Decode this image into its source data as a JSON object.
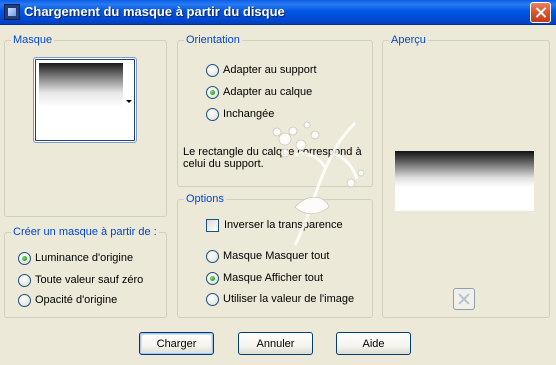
{
  "window": {
    "title": "Chargement du masque à partir du disque"
  },
  "groups": {
    "masque": "Masque",
    "orientation": "Orientation",
    "apercu": "Aperçu",
    "creer": "Créer un masque à partir de :",
    "options": "Options"
  },
  "orientation": {
    "options": [
      "Adapter au support",
      "Adapter au calque",
      "Inchangée"
    ],
    "selected": 1,
    "description_line1": "Le rectangle du calque correspond à",
    "description_line2": "celui du support."
  },
  "creer": {
    "options": [
      "Luminance d'origine",
      "Toute valeur sauf zéro",
      "Opacité d'origine"
    ],
    "selected": 0
  },
  "options": {
    "invert_label": "Inverser la transparence",
    "invert_checked": false,
    "radios": [
      "Masque Masquer tout",
      "Masque Afficher tout",
      "Utiliser la valeur de l'image"
    ],
    "selected": 1
  },
  "buttons": {
    "charger": "Charger",
    "annuler": "Annuler",
    "aide": "Aide"
  },
  "icons": {
    "window_icon": "app-icon",
    "close": "close-icon",
    "dropdown": "chevron-down-icon",
    "preview": "cross-icon"
  },
  "colors": {
    "titlebar": "#0058e6",
    "group_label": "#0046d5",
    "dialog_bg": "#ece9d8",
    "radio_checked": "#21a121"
  }
}
